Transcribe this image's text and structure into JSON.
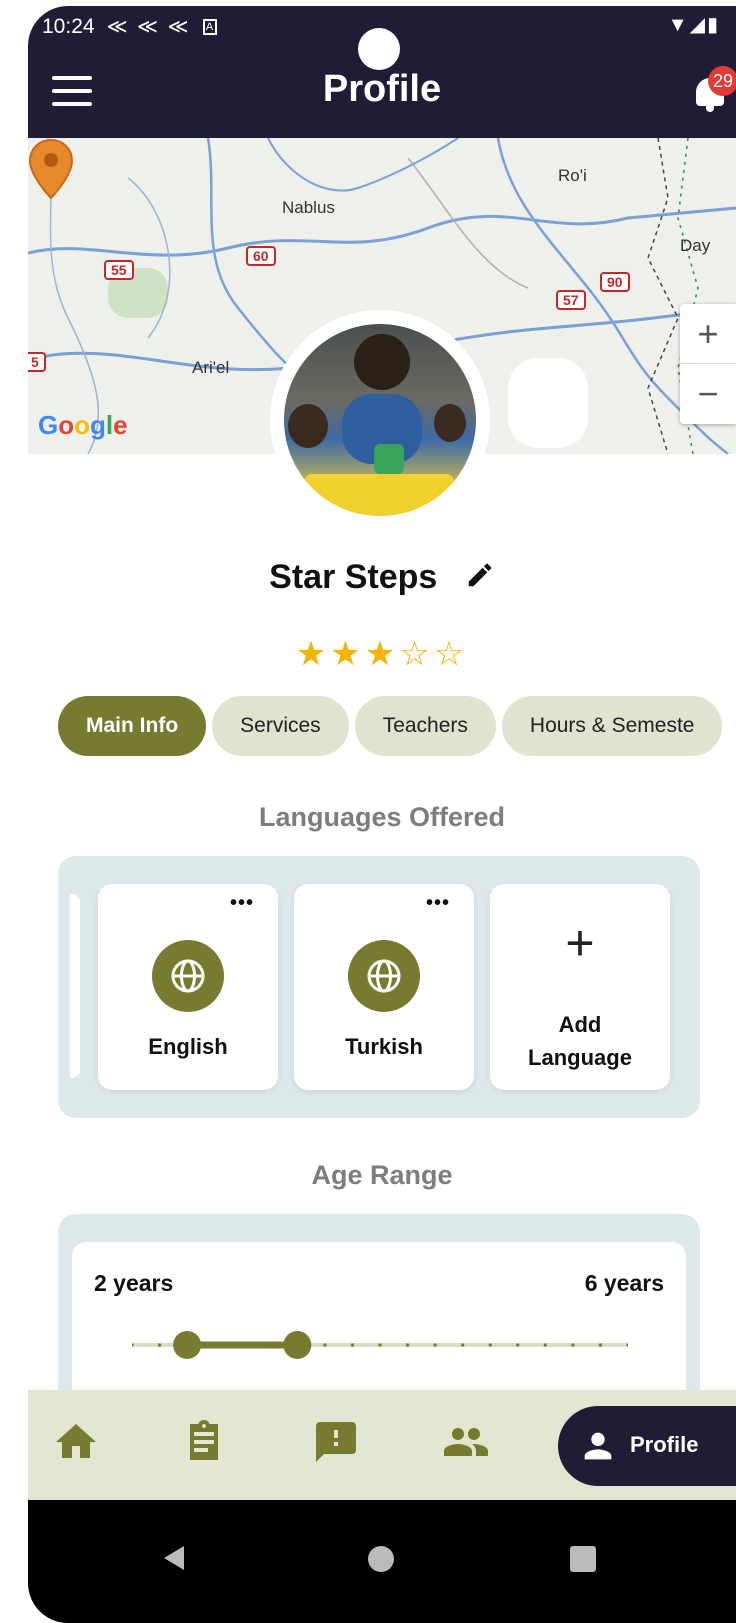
{
  "status_bar": {
    "time": "10:24",
    "left_icons": [
      "flutter-icon",
      "flutter-icon",
      "flutter-icon",
      "a-box-icon"
    ],
    "right_icons": [
      "wifi-icon",
      "signal-icon",
      "battery-icon"
    ]
  },
  "header": {
    "title": "Profile",
    "notification_count": "29"
  },
  "map": {
    "places": [
      "Nablus",
      "Ro'i",
      "Ari'el",
      "Day"
    ],
    "routes": [
      "55",
      "60",
      "90",
      "57",
      "5"
    ],
    "zoom_in": "+",
    "zoom_out": "−",
    "brand": "Google"
  },
  "profile": {
    "name": "Star Steps",
    "rating": 3,
    "max_rating": 5,
    "star_full": "★★★",
    "star_empty": "☆☆"
  },
  "tabs": [
    {
      "label": "Main Info",
      "active": true
    },
    {
      "label": "Services",
      "active": false
    },
    {
      "label": "Teachers",
      "active": false
    },
    {
      "label": "Hours & Semeste",
      "active": false
    }
  ],
  "languages": {
    "title": "Languages Offered",
    "items": [
      {
        "name": "English",
        "menu": "•••"
      },
      {
        "name": "Turkish",
        "menu": "•••"
      }
    ],
    "add": {
      "icon": "+",
      "label_line1": "Add",
      "label_line2": "Language"
    }
  },
  "age_range": {
    "title": "Age Range",
    "min_label": "2 years",
    "max_label": "6 years",
    "min": 2,
    "max": 6,
    "range_min": 0,
    "range_max": 18
  },
  "bottom_nav": {
    "items": [
      "home-icon",
      "clipboard-icon",
      "feedback-icon",
      "people-icon"
    ],
    "active_label": "Profile"
  },
  "colors": {
    "primary": "#211b36",
    "accent": "#767b2f",
    "tab_bg": "#dfe3cf",
    "panel": "#dde8ea",
    "star": "#f5b400",
    "badge": "#e53935"
  }
}
